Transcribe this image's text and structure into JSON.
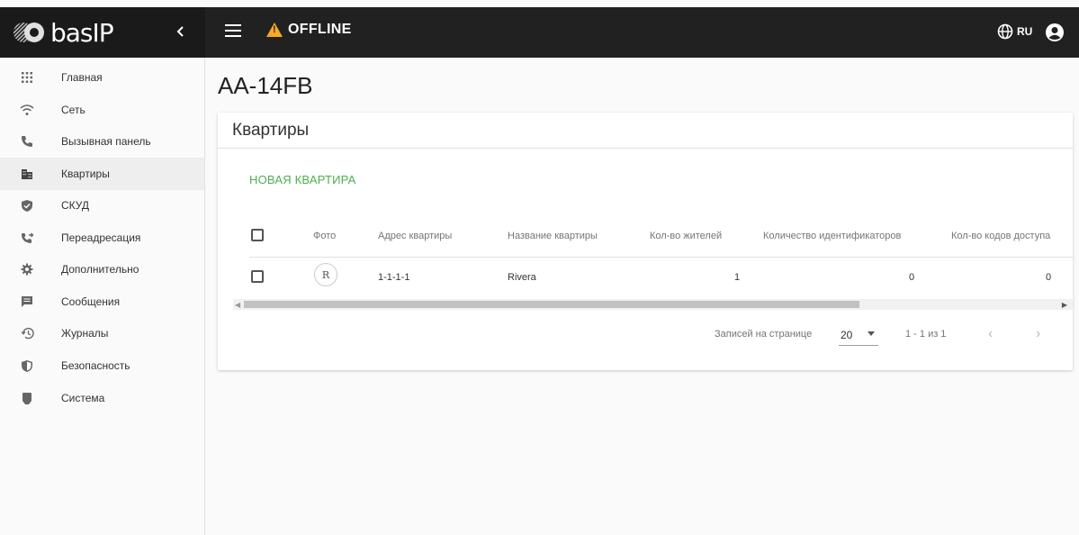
{
  "app": {
    "brand": "basIP",
    "status": "OFFLINE",
    "language": "RU",
    "accent_color": "#4caf50",
    "warning_color": "#f9a825",
    "topbar_color": "#212121"
  },
  "sidebar": {
    "collapse_icon": "chevron-left-icon",
    "items": [
      {
        "label": "Главная",
        "icon": "grid-icon"
      },
      {
        "label": "Сеть",
        "icon": "wifi-icon"
      },
      {
        "label": "Вызывная панель",
        "icon": "phone-icon"
      },
      {
        "label": "Квартиры",
        "icon": "building-icon",
        "active": true
      },
      {
        "label": "СКУД",
        "icon": "shield-check-icon"
      },
      {
        "label": "Переадресация",
        "icon": "phone-forward-icon"
      },
      {
        "label": "Дополнительно",
        "icon": "gear-icon"
      },
      {
        "label": "Сообщения",
        "icon": "message-icon"
      },
      {
        "label": "Журналы",
        "icon": "history-icon"
      },
      {
        "label": "Безопасность",
        "icon": "security-shield-icon"
      },
      {
        "label": "Система",
        "icon": "device-icon"
      }
    ]
  },
  "main": {
    "page_title": "AA-14FB",
    "card": {
      "title": "Квартиры",
      "new_button": "НОВАЯ КВАРТИРА",
      "columns": [
        "Фото",
        "Адрес квартиры",
        "Название квартиры",
        "Кол-во жителей",
        "Количество идентификаторов",
        "Кол-во кодов доступа"
      ],
      "rows": [
        {
          "photo_initial": "R",
          "address": "1-1-1-1",
          "name": "Rivera",
          "residents": "1",
          "identifiers": "0",
          "access_codes": "0"
        }
      ],
      "pagination": {
        "rows_per_page_label": "Записей на странице",
        "rows_per_page_value": "20",
        "range": "1 - 1 из 1",
        "prev": "‹",
        "next": "›"
      }
    }
  }
}
